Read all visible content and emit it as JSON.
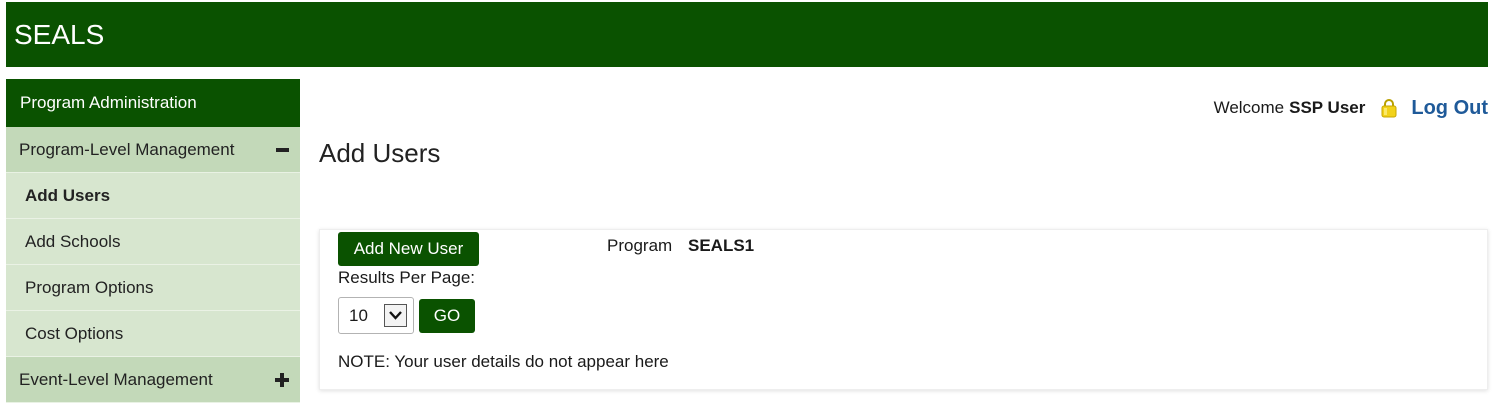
{
  "header": {
    "title": "SEALS"
  },
  "sidebar": {
    "header_label": "Program Administration",
    "sections": [
      {
        "label": "Program-Level Management",
        "toggle_icon": "minus-icon",
        "items": [
          {
            "label": "Add Users",
            "active": true
          },
          {
            "label": "Add Schools",
            "active": false
          },
          {
            "label": "Program Options",
            "active": false
          },
          {
            "label": "Cost Options",
            "active": false
          }
        ]
      },
      {
        "label": "Event-Level Management",
        "toggle_icon": "plus-icon"
      }
    ]
  },
  "user_bar": {
    "welcome_text": "Welcome",
    "username": "SSP User",
    "lock_icon": "lock-icon",
    "logout_label": "Log Out"
  },
  "page": {
    "title": "Add Users"
  },
  "panel": {
    "add_user_label": "Add New User",
    "program_label": "Program",
    "program_value": "SEALS1",
    "results_per_page_label": "Results Per Page:",
    "results_per_page_value": "10",
    "go_label": "GO",
    "note": "NOTE: Your user details do not appear here"
  },
  "colors": {
    "brand_green": "#0a5200",
    "sidebar_section": "#c3d9b9",
    "sidebar_item": "#d7e6cf",
    "link_blue": "#1f5a99"
  }
}
